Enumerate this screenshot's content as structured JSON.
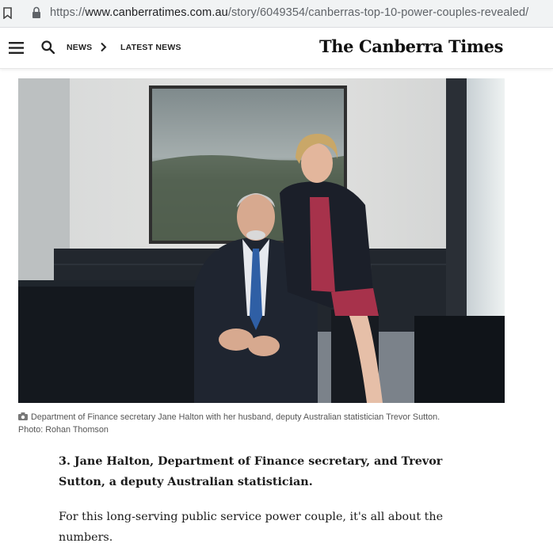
{
  "browser": {
    "url_scheme": "https://",
    "url_host": "www.canberratimes.com.au",
    "url_path": "/story/6049354/canberras-top-10-power-couples-revealed/"
  },
  "header": {
    "breadcrumb_news": "NEWS",
    "breadcrumb_latest": "LATEST NEWS",
    "logo": "The Canberra Times"
  },
  "photo": {
    "caption": "Department of Finance secretary Jane Halton with her husband, deputy Australian statistician Trevor Sutton.",
    "credit": "Photo: Rohan Thomson"
  },
  "article": {
    "lead": "3. Jane Halton, Department of Finance secretary, and Trevor Sutton, a deputy Australian statistician.",
    "paragraph": "For this long-serving public service power couple, it's all about the numbers."
  },
  "icons": [
    "bookmark-icon",
    "lock-icon",
    "menu-icon",
    "search-icon",
    "chevron-right-icon",
    "camera-icon"
  ]
}
